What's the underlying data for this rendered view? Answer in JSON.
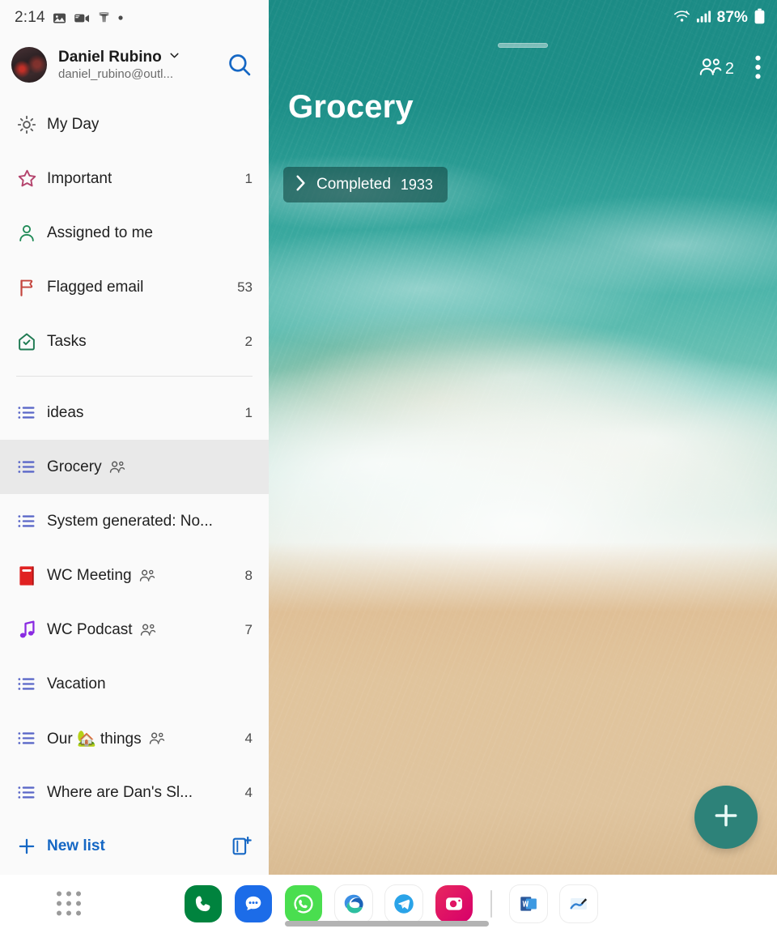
{
  "status_bar": {
    "time": "2:14",
    "left_icons": [
      "photo-icon",
      "video-call-icon",
      "tesla-icon",
      "dot-icon"
    ],
    "battery_percent": "87%",
    "right_icons": [
      "wifi-icon",
      "signal-icon",
      "battery-icon"
    ]
  },
  "account": {
    "name": "Daniel Rubino",
    "email": "daniel_rubino@outl...",
    "chevron": "chevron-down-icon",
    "avatar": "avatar",
    "search": "search-icon"
  },
  "smart_lists": [
    {
      "label": "My Day",
      "icon": "sun-icon",
      "count": "",
      "color": "#5b5b5b",
      "shared": false
    },
    {
      "label": "Important",
      "icon": "star-icon",
      "count": "1",
      "color": "#b4436c",
      "shared": false
    },
    {
      "label": "Assigned to me",
      "icon": "person-icon",
      "count": "",
      "color": "#1f8a56",
      "shared": false
    },
    {
      "label": "Flagged email",
      "icon": "flag-icon",
      "count": "53",
      "color": "#c4443d",
      "shared": false
    },
    {
      "label": "Tasks",
      "icon": "home-check-icon",
      "count": "2",
      "color": "#1f7a52",
      "shared": false
    }
  ],
  "custom_lists": [
    {
      "label": "ideas",
      "icon": "list-icon",
      "count": "1",
      "color": "#5a67c8",
      "shared": false,
      "selected": false,
      "truncated": false
    },
    {
      "label": "Grocery",
      "icon": "list-icon",
      "count": "",
      "color": "#5a67c8",
      "shared": true,
      "selected": true,
      "truncated": false
    },
    {
      "label": "System generated: No...",
      "icon": "list-icon",
      "count": "",
      "color": "#5a67c8",
      "shared": false,
      "selected": false,
      "truncated": true
    },
    {
      "label": "WC Meeting",
      "icon": "book-icon",
      "count": "8",
      "color": "#e02222",
      "shared": true,
      "selected": false,
      "truncated": false
    },
    {
      "label": "WC Podcast",
      "icon": "music-icon",
      "count": "7",
      "color": "#8a2be2",
      "shared": true,
      "selected": false,
      "truncated": false
    },
    {
      "label": "Vacation",
      "icon": "list-icon",
      "count": "",
      "color": "#5a67c8",
      "shared": false,
      "selected": false,
      "truncated": false
    },
    {
      "label": "Our 🏡 things",
      "icon": "list-icon",
      "count": "4",
      "color": "#5a67c8",
      "shared": true,
      "selected": false,
      "truncated": false
    },
    {
      "label": "Where are Dan's Sl...",
      "icon": "list-icon",
      "count": "4",
      "color": "#5a67c8",
      "shared": false,
      "selected": false,
      "truncated": true
    }
  ],
  "new_list": {
    "label": "New list",
    "plus_icon": "plus-icon",
    "new_group_icon": "new-group-icon",
    "color": "#1567c4"
  },
  "detail": {
    "title": "Grocery",
    "completed_label": "Completed",
    "completed_count": "1933",
    "chevron": "chevron-right-icon",
    "share_count": "2",
    "share_icon": "people-icon",
    "menu_icon": "more-vertical-icon",
    "fab_icon": "plus-icon",
    "fab_color": "#2d8279",
    "background": "beach-aerial-photo"
  },
  "taskbar": {
    "apps_grid": "apps-grid-icon",
    "apps": [
      {
        "name": "samsung-phone-icon",
        "label": "Phone"
      },
      {
        "name": "samsung-messages-icon",
        "label": "Messages"
      },
      {
        "name": "whatsapp-icon",
        "label": "WhatsApp"
      },
      {
        "name": "microsoft-edge-icon",
        "label": "Edge"
      },
      {
        "name": "telegram-icon",
        "label": "Telegram"
      },
      {
        "name": "instagram-icon",
        "label": "Instagram"
      },
      {
        "name": "microsoft-word-icon",
        "label": "Word"
      },
      {
        "name": "onedrive-sketch-icon",
        "label": "Sketch"
      }
    ]
  }
}
